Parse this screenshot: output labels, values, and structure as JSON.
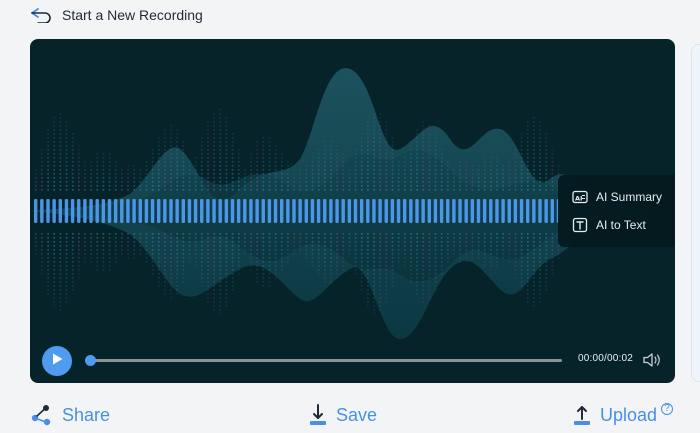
{
  "header": {
    "back_label": "Start a New Recording"
  },
  "player": {
    "time_display": "00:00/00:02",
    "progress_fraction": 0.0,
    "accent": "#4f9bf0",
    "background": "#06232a"
  },
  "ai_menu": {
    "items": [
      {
        "label": "AI Summary",
        "icon": "summary-icon"
      },
      {
        "label": "AI to Text",
        "icon": "text-icon"
      }
    ]
  },
  "actions": {
    "share_label": "Share",
    "save_label": "Save",
    "upload_label": "Upload",
    "help_glyph": "?"
  }
}
